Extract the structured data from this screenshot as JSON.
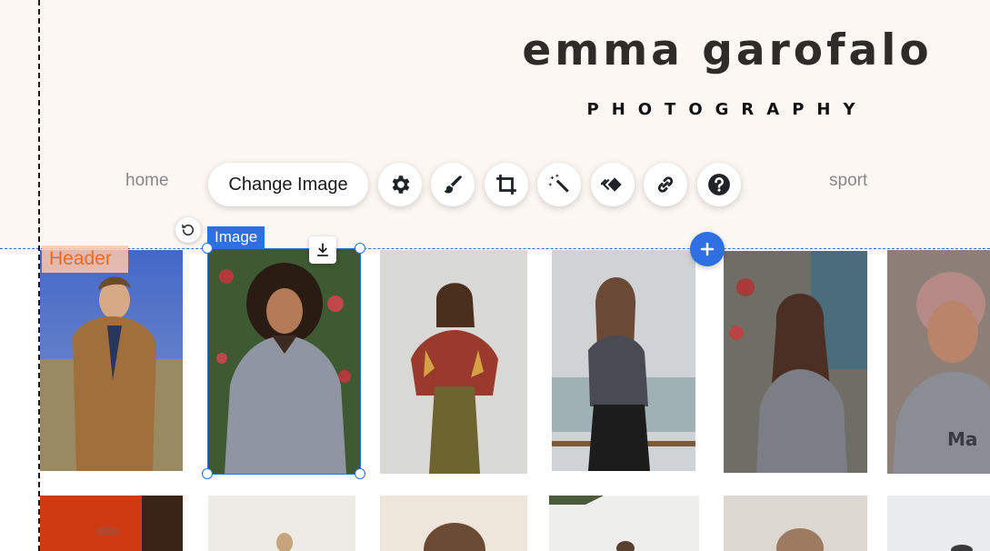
{
  "brand": {
    "name": "emma garofalo",
    "subtitle": "PHOTOGRAPHY"
  },
  "nav": {
    "items": [
      {
        "label": "home"
      },
      {
        "label": "sport"
      }
    ]
  },
  "toolbar": {
    "change_image_label": "Change Image",
    "tools": [
      {
        "icon": "settings-icon"
      },
      {
        "icon": "design-brush-icon"
      },
      {
        "icon": "crop-icon"
      },
      {
        "icon": "magic-wand-icon"
      },
      {
        "icon": "animation-icon"
      },
      {
        "icon": "link-icon"
      },
      {
        "icon": "help-icon"
      }
    ]
  },
  "labels": {
    "image_tag": "Image",
    "header_tag": "Header"
  },
  "colors": {
    "accent": "#2f6fe4",
    "header_bg": "#fdf7f4",
    "header_tag_text": "#f06a1a"
  },
  "gallery": {
    "row1": [
      {
        "subject": "man-in-tan-coat"
      },
      {
        "subject": "woman-curly-hair-gray-sweater",
        "selected": true
      },
      {
        "subject": "woman-patterned-jacket"
      },
      {
        "subject": "woman-striped-top-balcony"
      },
      {
        "subject": "woman-long-hair-gray-sweater"
      },
      {
        "subject": "woman-pink-hair-gray-tee"
      }
    ],
    "row2": [
      {
        "subject": "orange-wall-partial"
      },
      {
        "subject": "light-partial"
      },
      {
        "subject": "light-partial"
      },
      {
        "subject": "light-partial"
      },
      {
        "subject": "light-partial"
      },
      {
        "subject": "light-partial"
      }
    ]
  }
}
